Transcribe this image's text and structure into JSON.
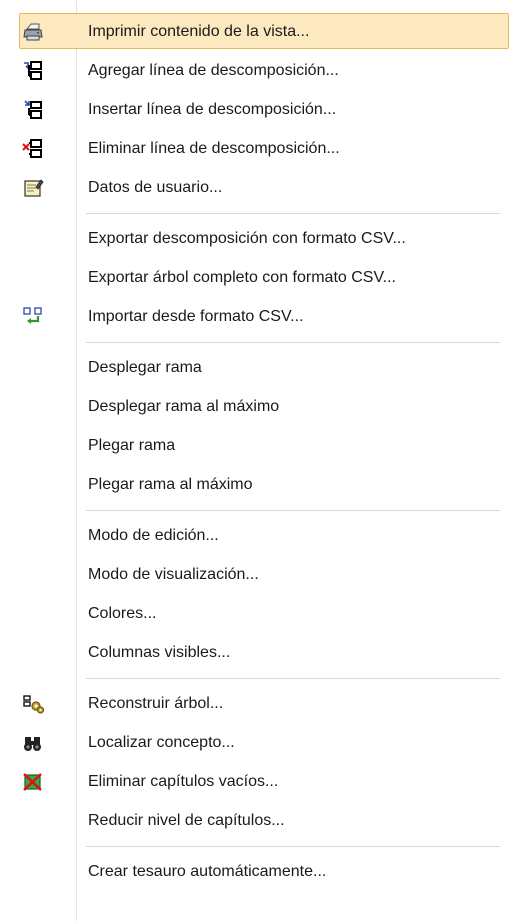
{
  "menu": {
    "groups": [
      [
        {
          "label": "Imprimir contenido de la vista...",
          "icon": "printer-icon"
        },
        {
          "label": "Agregar línea de descomposición...",
          "icon": "add-line-icon"
        },
        {
          "label": "Insertar línea de descomposición...",
          "icon": "insert-line-icon"
        },
        {
          "label": "Eliminar línea de descomposición...",
          "icon": "delete-line-icon"
        },
        {
          "label": "Datos de usuario...",
          "icon": "user-data-icon"
        }
      ],
      [
        {
          "label": "Exportar descomposición con formato CSV...",
          "icon": ""
        },
        {
          "label": "Exportar árbol completo con formato CSV...",
          "icon": ""
        },
        {
          "label": "Importar desde formato CSV...",
          "icon": "import-csv-icon"
        }
      ],
      [
        {
          "label": "Desplegar rama",
          "icon": ""
        },
        {
          "label": "Desplegar rama al máximo",
          "icon": ""
        },
        {
          "label": "Plegar rama",
          "icon": ""
        },
        {
          "label": "Plegar rama al máximo",
          "icon": ""
        }
      ],
      [
        {
          "label": "Modo de edición...",
          "icon": ""
        },
        {
          "label": "Modo de visualización...",
          "icon": ""
        },
        {
          "label": "Colores...",
          "icon": ""
        },
        {
          "label": "Columnas visibles...",
          "icon": ""
        }
      ],
      [
        {
          "label": "Reconstruir árbol...",
          "icon": "rebuild-tree-icon"
        },
        {
          "label": "Localizar concepto...",
          "icon": "binoculars-icon"
        },
        {
          "label": "Eliminar capítulos vacíos...",
          "icon": "delete-empty-chapters-icon"
        },
        {
          "label": "Reducir nivel de capítulos...",
          "icon": ""
        }
      ],
      [
        {
          "label": "Crear tesauro automáticamente...",
          "icon": ""
        }
      ]
    ]
  }
}
